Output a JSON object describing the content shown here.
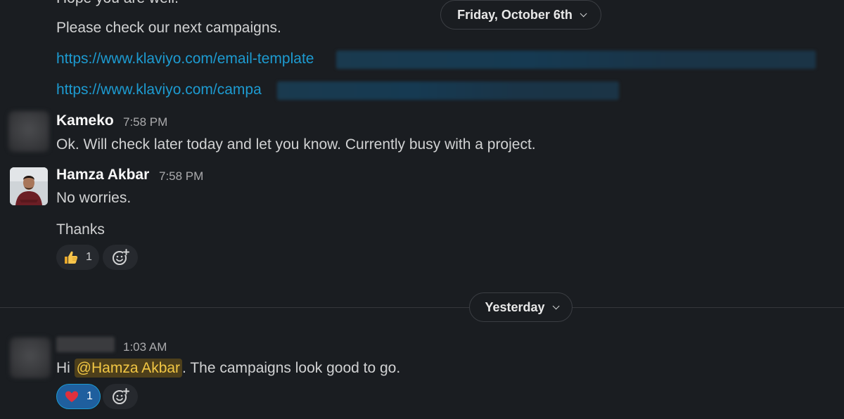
{
  "messages": {
    "m1": {
      "partial_line": "Hope you are well.",
      "line2": "Please check our next campaigns.",
      "link1": "https://www.klaviyo.com/email-template",
      "link2": "https://www.klaviyo.com/campa"
    },
    "m2": {
      "author": "Kameko",
      "time": "7:58 PM",
      "text": "Ok. Will check later today and let you know. Currently busy with a project."
    },
    "m3": {
      "author": "Hamza Akbar",
      "time": "7:58 PM",
      "line1": "No worries.",
      "line2": "Thanks",
      "reaction_count": "1"
    },
    "m4": {
      "time": "1:03 AM",
      "prefix": "Hi ",
      "mention": "@Hamza Akbar",
      "suffix": ". The campaigns look good to go.",
      "reaction_count": "1"
    }
  },
  "dividers": {
    "friday": "Friday, October 6th",
    "yesterday": "Yesterday"
  },
  "icons": {
    "thumbs_up": "thumbs-up-icon",
    "heart": "heart-icon",
    "add_reaction": "add-reaction-icon",
    "chevron": "chevron-down-icon"
  },
  "colors": {
    "background": "#1a1d21",
    "link": "#1d9bd1",
    "mention_bg": "#4d3f1b",
    "mention_text": "#f2c744",
    "active_reaction": "#1f5f9e"
  }
}
